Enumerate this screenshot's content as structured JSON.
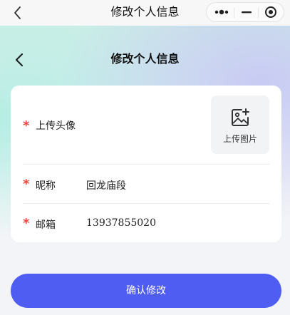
{
  "topbar": {
    "title": "修改个人信息",
    "icons": [
      "back-arrow-icon",
      "more-dots-icon",
      "minimize-icon",
      "close-target-icon"
    ]
  },
  "page": {
    "title": "修改个人信息",
    "back_icon": "back-arrow-icon"
  },
  "form": {
    "required_mark": "*",
    "avatar": {
      "label": "上传头像",
      "upload_label": "上传图片",
      "upload_icon": "image-add-icon"
    },
    "nickname": {
      "label": "昵称",
      "value": "回龙庙段"
    },
    "email": {
      "label": "邮箱",
      "value": "13937855020"
    }
  },
  "confirm_button": {
    "label": "确认修改"
  },
  "colors": {
    "accent": "#4f5df3",
    "required": "#f0443c",
    "card": "#ffffff"
  }
}
